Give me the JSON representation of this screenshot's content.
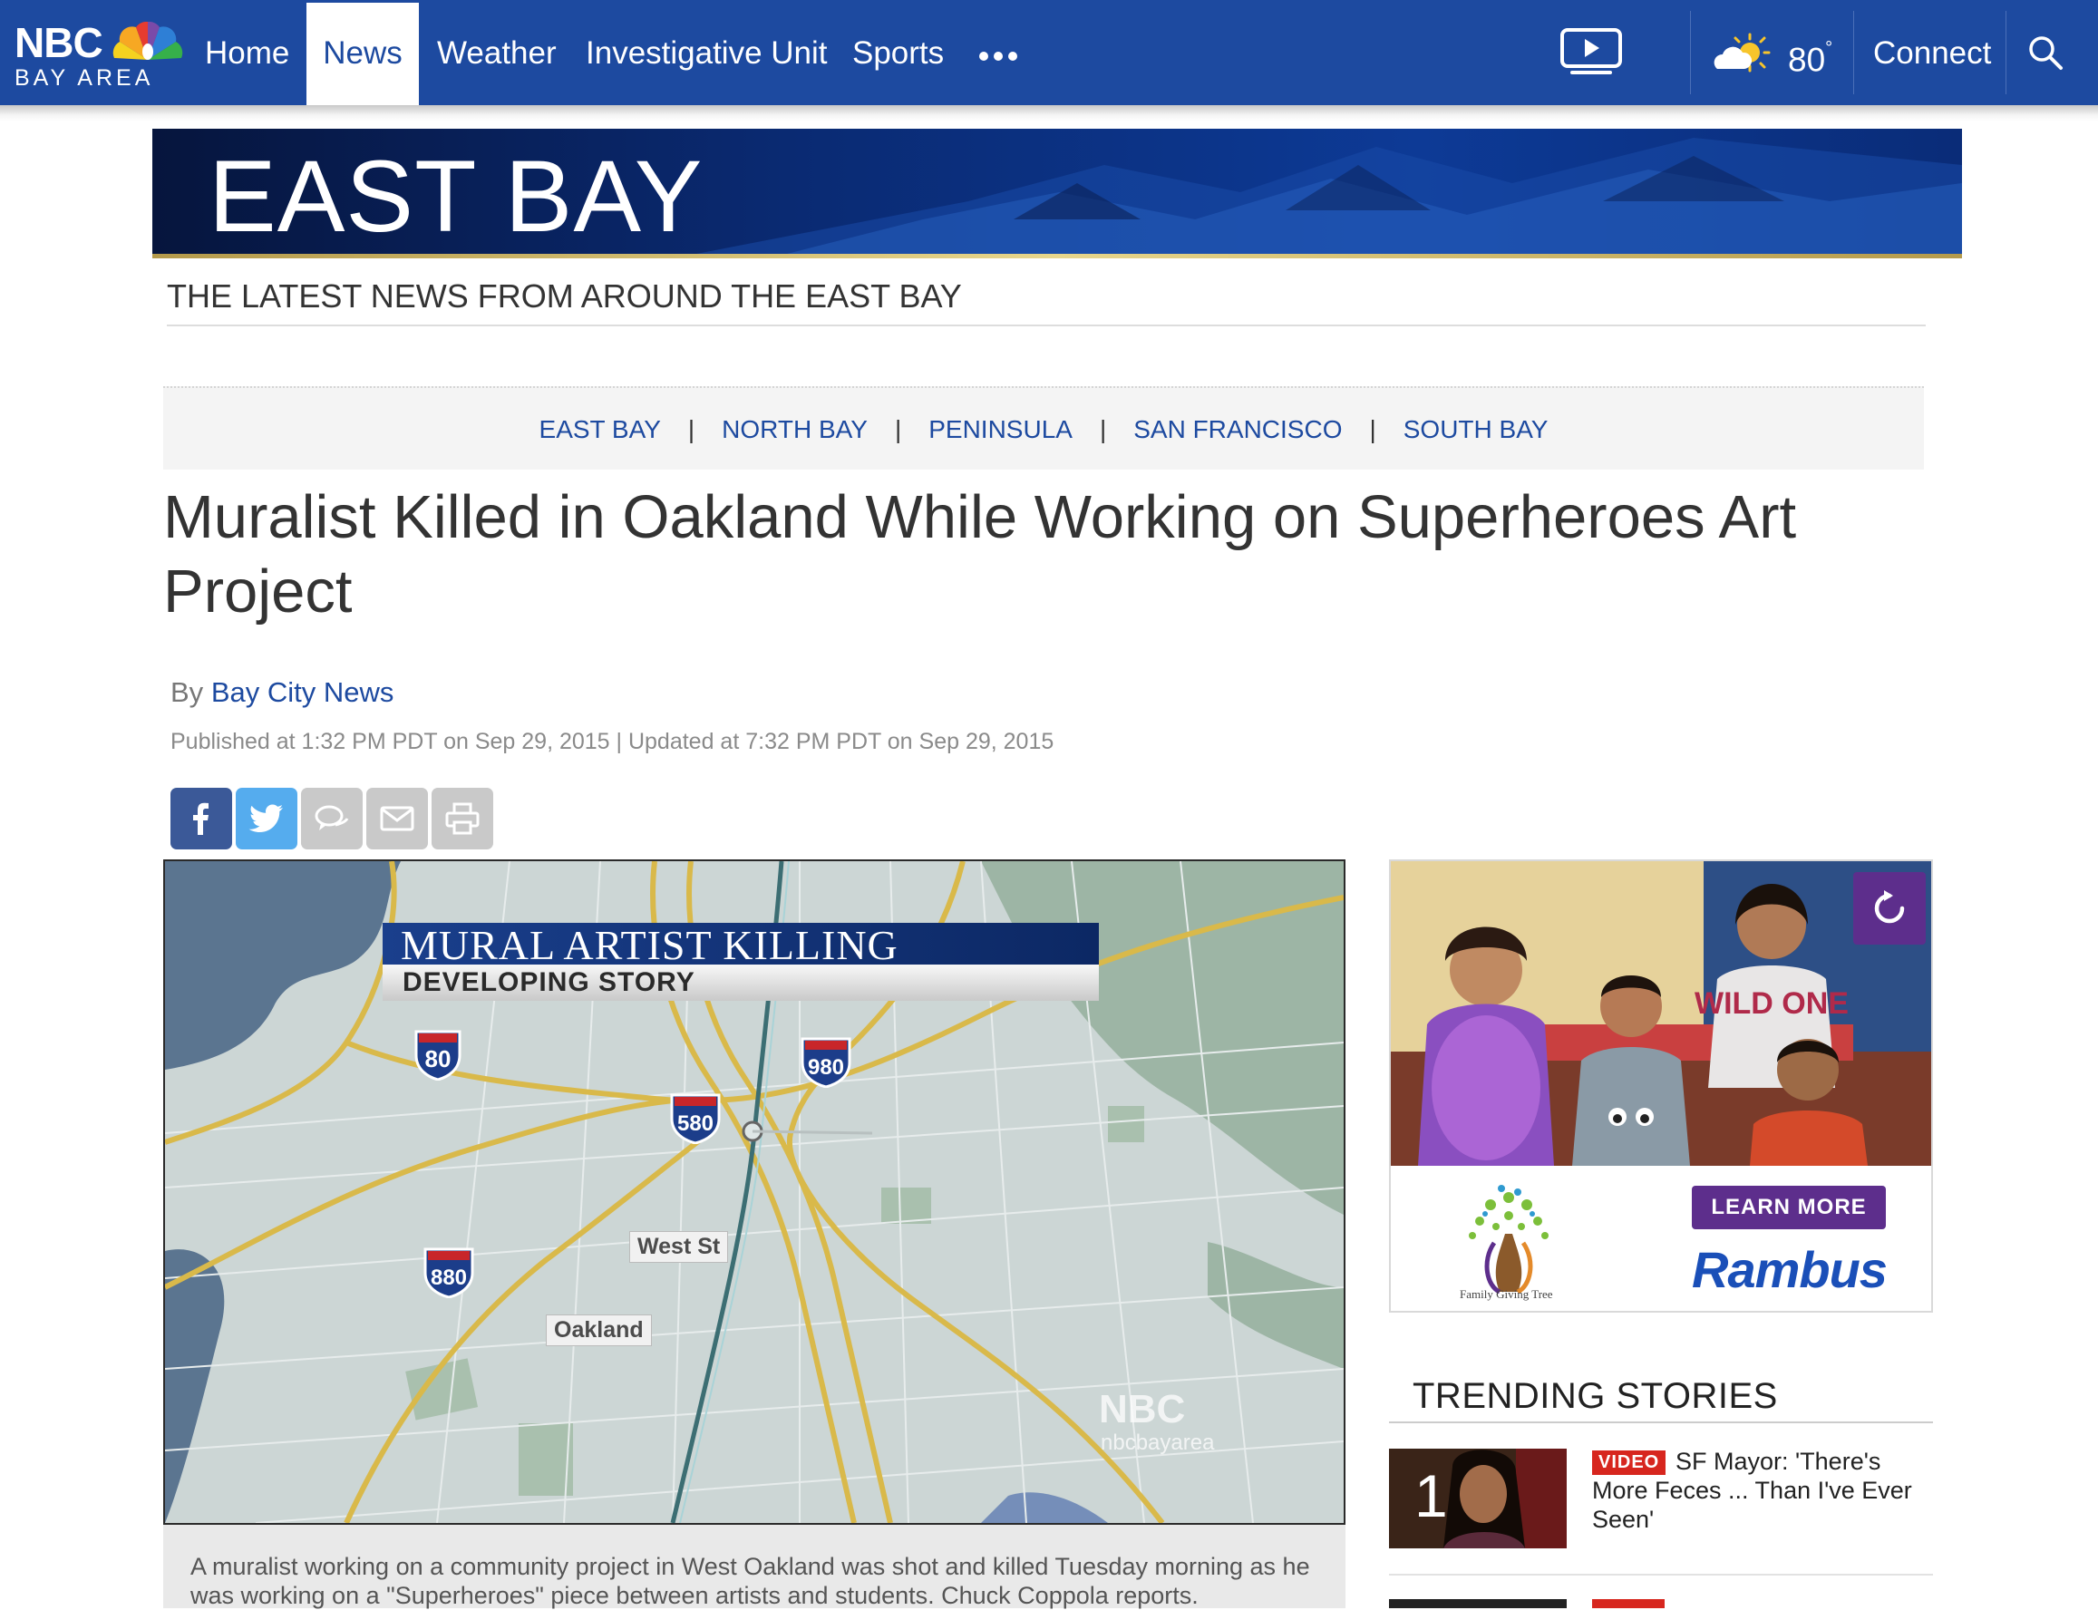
{
  "nav": {
    "logo_text": "NBC",
    "logo_subtext": "BAY AREA",
    "items": [
      {
        "label": "Home"
      },
      {
        "label": "News"
      },
      {
        "label": "Weather"
      },
      {
        "label": "Investigative Unit"
      },
      {
        "label": "Sports"
      }
    ],
    "active": "News",
    "temperature": "80",
    "temperature_unit": "°",
    "connect_label": "Connect"
  },
  "section": {
    "banner_title": "EAST BAY",
    "tagline": "THE LATEST NEWS FROM AROUND THE EAST BAY"
  },
  "regions": [
    {
      "label": "EAST BAY"
    },
    {
      "label": "NORTH BAY"
    },
    {
      "label": "PENINSULA"
    },
    {
      "label": "SAN FRANCISCO"
    },
    {
      "label": "SOUTH BAY"
    }
  ],
  "region_separator": "|",
  "article": {
    "headline": "Muralist Killed in Oakland While Working on Superheroes Art Project",
    "by_prefix": "By",
    "author": "Bay City News",
    "dateline": "Published at 1:32 PM PDT on Sep 29, 2015 | Updated at 7:32 PM PDT on Sep 29, 2015",
    "caption": "A muralist working on a community project in West Oakland was shot and killed Tuesday morning as he was working on a \"Superheroes\" piece between artists and students. Chuck Coppola reports."
  },
  "video": {
    "lower_third_title": "MURAL ARTIST KILLING",
    "lower_third_subtitle": "DEVELOPING STORY",
    "labels": {
      "street": "West St",
      "city": "Oakland"
    },
    "highways": [
      "80",
      "980",
      "580",
      "880"
    ],
    "watermark_logo": "NBC",
    "watermark_handle": "nbcbayarea"
  },
  "ad": {
    "sponsor_text": "Family Giving Tree",
    "cta": "LEARN MORE",
    "brand": "Rambus",
    "shirt_text": "WILD ONE"
  },
  "trending": {
    "title": "TRENDING STORIES",
    "items": [
      {
        "rank": "1",
        "badge": "VIDEO",
        "title": "SF Mayor: 'There's More Feces ... Than I've Ever Seen'"
      }
    ]
  },
  "colors": {
    "nav_blue": "#1d4aa0",
    "link_blue": "#1d4aa0",
    "facebook": "#3b5998",
    "twitter": "#55acee",
    "ad_purple": "#5d2e8c",
    "badge_red": "#d7261e"
  },
  "icons": [
    "peacock-icon",
    "more-icon",
    "video-icon",
    "weather-partly-sunny-icon",
    "search-icon",
    "facebook-icon",
    "twitter-icon",
    "comment-icon",
    "email-icon",
    "print-icon",
    "refresh-icon"
  ]
}
